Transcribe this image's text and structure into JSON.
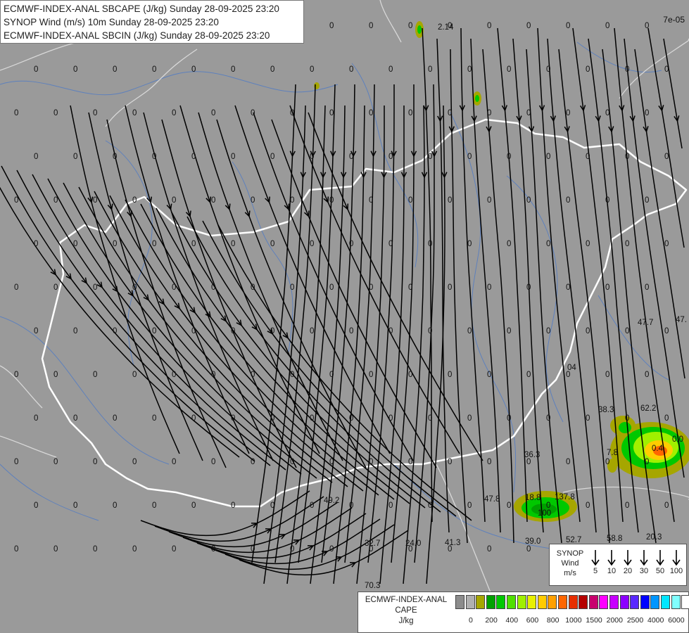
{
  "title_lines": [
    "ECMWF-INDEX-ANAL SBCAPE (J/kg) Sunday 28-09-2025 23:20",
    "SYNOP Wind (m/s) 10m Sunday 28-09-2025 23:20",
    "ECMWF-INDEX-ANAL SBCIN (J/kg) Sunday 28-09-2025 23:20"
  ],
  "corner_label": "7e-05",
  "station_values": [
    "2.14",
    "62.2",
    "38.3",
    "7.8",
    "36.3",
    "137.8",
    "18.8",
    "100",
    "39.0",
    "52.7",
    "58.8",
    "20.3",
    "47.8",
    "49.2",
    "32.7",
    "24.0",
    "41.3",
    "70.3",
    "47.7",
    "47.",
    "04",
    "0.4",
    "0.0"
  ],
  "zero_label": "0",
  "wind_legend": {
    "title_lines": [
      "SYNOP",
      "Wind",
      "m/s"
    ],
    "speeds": [
      "5",
      "10",
      "20",
      "30",
      "50",
      "100"
    ]
  },
  "cape_legend": {
    "title_lines": [
      "ECMWF-INDEX-ANAL",
      "CAPE",
      "J/kg"
    ],
    "colors": [
      "#8c8c8c",
      "#b0b0b0",
      "#a6a600",
      "#00a000",
      "#00c800",
      "#50e000",
      "#a0f000",
      "#e8f000",
      "#ffcc00",
      "#ffa000",
      "#ff6600",
      "#e62e00",
      "#b40000",
      "#c8006e",
      "#ff00ff",
      "#c800ff",
      "#8c00ff",
      "#5a28ff",
      "#0000ff",
      "#0096ff",
      "#00e6ff",
      "#80ffff",
      "#ffffff"
    ],
    "ticks": [
      "0",
      "200",
      "400",
      "600",
      "800",
      "1000",
      "1500",
      "2000",
      "2500",
      "4000",
      "6000"
    ]
  },
  "colors": {
    "background": "#9a9a9a",
    "streamline": "#000000",
    "border": "#ffffff",
    "river": "#4a78c8"
  }
}
